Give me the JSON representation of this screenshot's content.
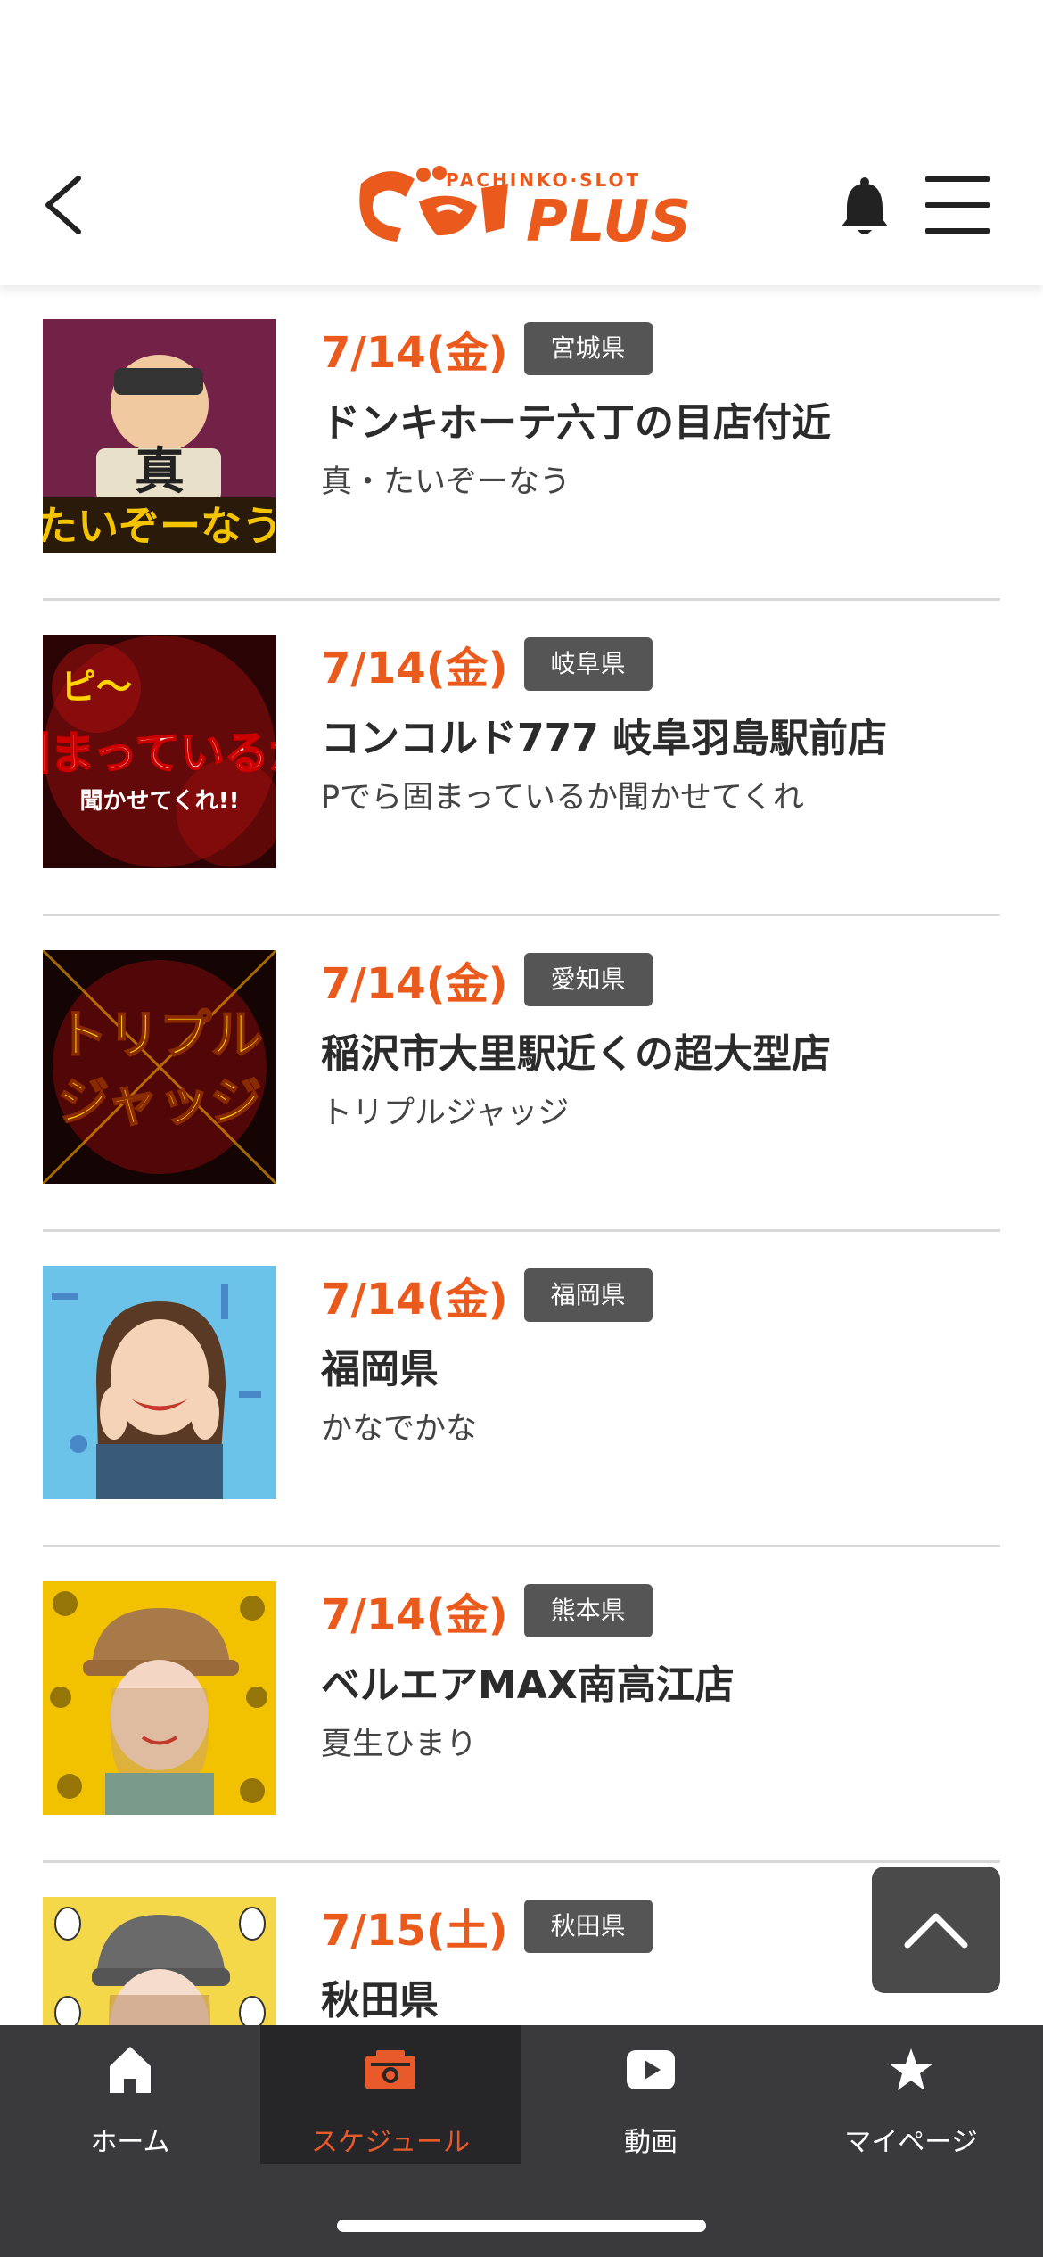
{
  "header": {
    "logo_sub": "PACHINKO·SLOT",
    "logo_main": "PLUS",
    "brand_color": "#ea5a1c",
    "icons": {
      "back": "chevron-left-icon",
      "notifications": "bell-icon",
      "menu": "hamburger-menu-icon"
    }
  },
  "schedule": [
    {
      "date": "7/14(金)",
      "prefecture": "宮城県",
      "venue": "ドンキホーテ六丁の目店付近",
      "performer": "真・たいぞーなう"
    },
    {
      "date": "7/14(金)",
      "prefecture": "岐阜県",
      "venue": "コンコルド777 岐阜羽島駅前店",
      "performer": "Pでら固まっているか聞かせてくれ"
    },
    {
      "date": "7/14(金)",
      "prefecture": "愛知県",
      "venue": "稲沢市大里駅近くの超大型店",
      "performer": "トリプルジャッジ"
    },
    {
      "date": "7/14(金)",
      "prefecture": "福岡県",
      "venue": "福岡県",
      "performer": "かなでかな"
    },
    {
      "date": "7/14(金)",
      "prefecture": "熊本県",
      "venue": "ベルエアMAX南高江店",
      "performer": "夏生ひまり"
    },
    {
      "date": "7/15(土)",
      "prefecture": "秋田県",
      "venue": "秋田県",
      "performer": ""
    }
  ],
  "scroll_top": {
    "icon": "chevron-up-icon"
  },
  "tabbar": {
    "active_color": "#e85a2a",
    "tabs": [
      {
        "label": "ホーム",
        "icon": "home-icon"
      },
      {
        "label": "スケジュール",
        "icon": "camera-icon"
      },
      {
        "label": "動画",
        "icon": "play-icon"
      },
      {
        "label": "マイページ",
        "icon": "star-icon"
      }
    ]
  }
}
